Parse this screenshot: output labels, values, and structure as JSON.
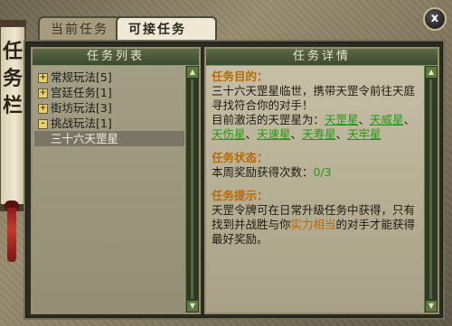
{
  "banner": {
    "chars": [
      "任",
      "务",
      "栏"
    ]
  },
  "tabs": {
    "current": "当前任务",
    "accept": "可接任务"
  },
  "close_label": "x",
  "list_panel": {
    "header": "任务列表",
    "categories": [
      {
        "label": "常规玩法[5]",
        "toggle": "+"
      },
      {
        "label": "宫廷任务[1]",
        "toggle": "+"
      },
      {
        "label": "街坊玩法[3]",
        "toggle": "+"
      },
      {
        "label": "挑战玩法[1]",
        "toggle": "-"
      }
    ],
    "selected_child": "三十六天罡星"
  },
  "detail_panel": {
    "header": "任务详情",
    "goal_title": "任务目的：",
    "goal_text": "三十六天罡星临世，携带天罡令前往天庭寻找符合你的对手！",
    "activated_prefix": "目前激活的天罡星为：",
    "stars": [
      "天罡星",
      "天威星",
      "天伤星",
      "天速星",
      "天寿星",
      "天牢星"
    ],
    "status_title": "任务状态：",
    "status_label": "本周奖励获得次数：",
    "status_value": "0/3",
    "tip_title": "任务提示：",
    "tip_before": "天罡令牌可在日常升级任务中获得，只有找到并战胜与你",
    "tip_highlight": "实力相当",
    "tip_after": "的对手才能获得最好奖励。"
  },
  "colors": {
    "accent": "#b86c00",
    "link": "#1f9a14"
  }
}
